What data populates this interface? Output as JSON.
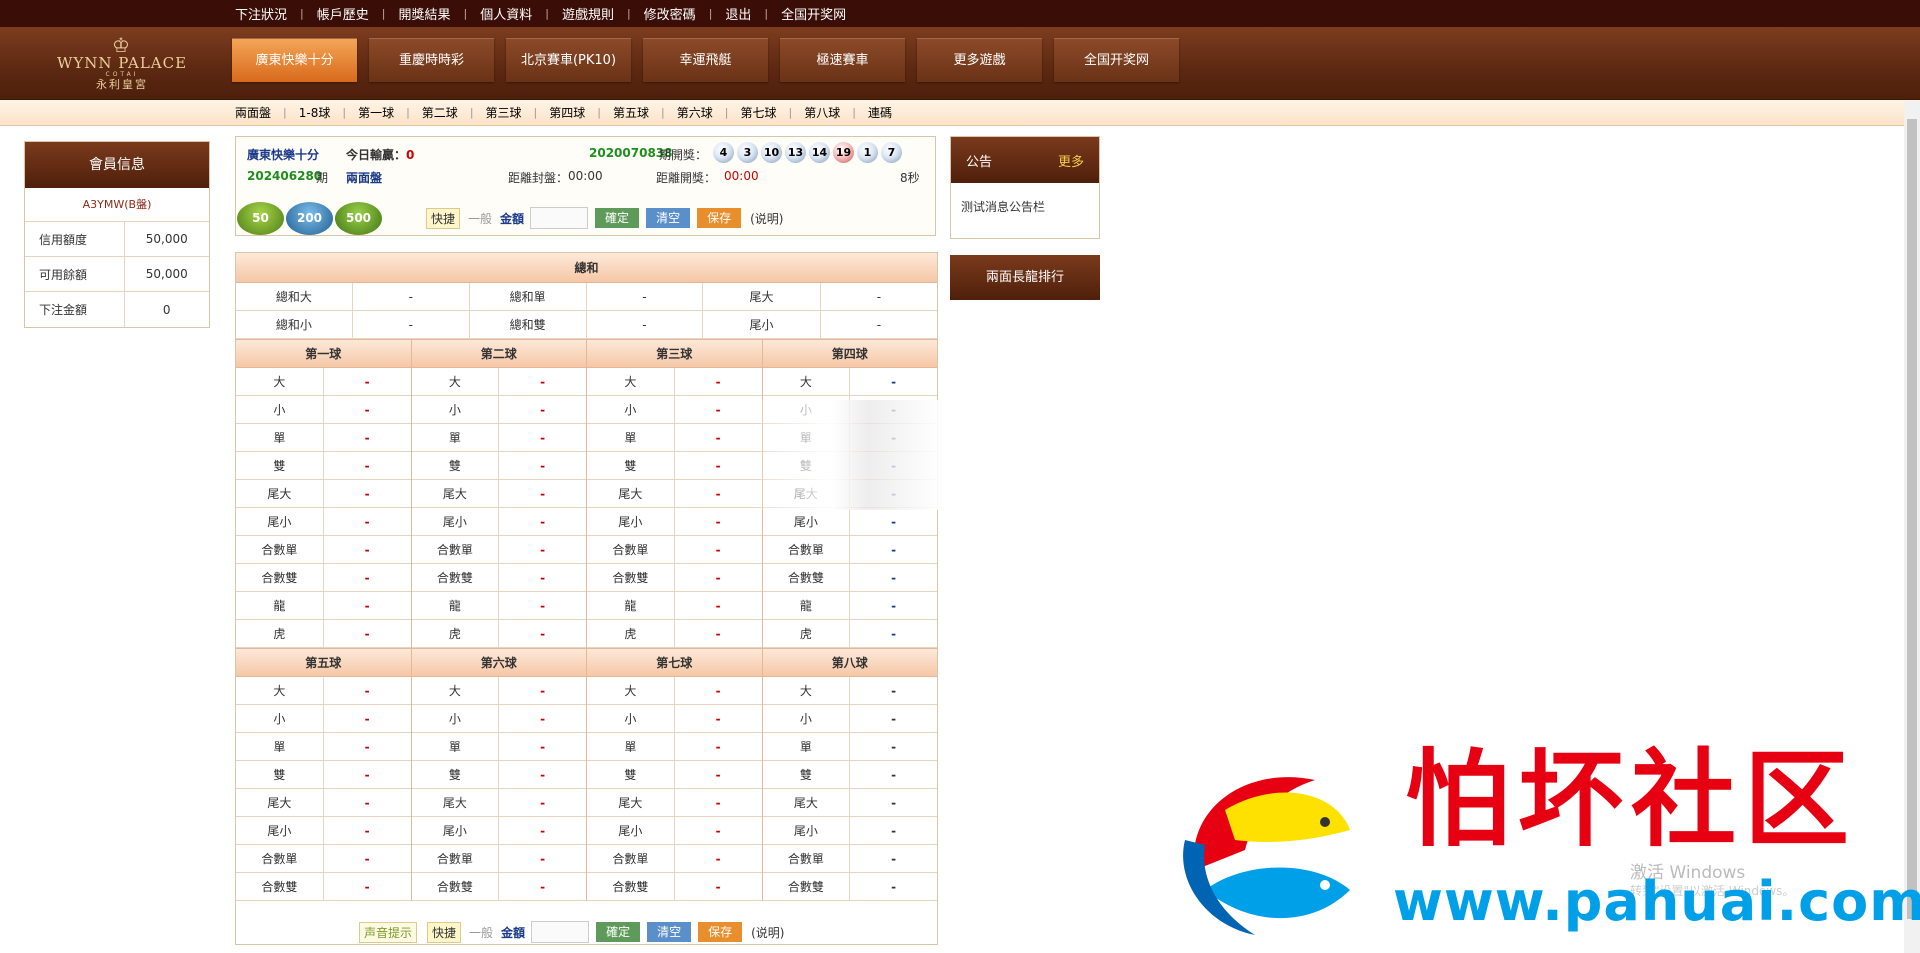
{
  "topnav": [
    "下注狀況",
    "帳戶歷史",
    "開獎結果",
    "個人資料",
    "遊戲規則",
    "修改密碼",
    "退出",
    "全国开奖网"
  ],
  "logo": {
    "en": "WYNN PALACE",
    "sub": "COTAI",
    "cn": "永利皇宮"
  },
  "games": [
    "廣東快樂十分",
    "重慶時時彩",
    "北京賽車(PK10)",
    "幸運飛艇",
    "極速賽車",
    "更多遊戲",
    "全国开奖网"
  ],
  "subnav": [
    "兩面盤",
    "1-8球",
    "第一球",
    "第二球",
    "第三球",
    "第四球",
    "第五球",
    "第六球",
    "第七球",
    "第八球",
    "連碼"
  ],
  "member": {
    "title": "會員信息",
    "user": "A3YMW(B盤)",
    "rows": [
      {
        "k": "信用額度",
        "v": "50,000"
      },
      {
        "k": "可用餘額",
        "v": "50,000"
      },
      {
        "k": "下注金額",
        "v": "0"
      }
    ]
  },
  "info": {
    "game": "廣東快樂十分",
    "today_label": "今日輸贏：",
    "today_val": "0",
    "draw_no": "2020070838",
    "draw_label": "期開獎：",
    "balls": [
      {
        "n": "4",
        "c": "blue"
      },
      {
        "n": "3",
        "c": "blue"
      },
      {
        "n": "10",
        "c": "blue"
      },
      {
        "n": "13",
        "c": "blue"
      },
      {
        "n": "14",
        "c": "blue"
      },
      {
        "n": "19",
        "c": "red"
      },
      {
        "n": "1",
        "c": "blue"
      },
      {
        "n": "7",
        "c": "blue"
      }
    ],
    "issue": "202406280",
    "qi": "期",
    "mode": "兩面盤",
    "close_label": "距離封盤：",
    "close_val": "00:00",
    "open_label": "距離開獎：",
    "open_val": "00:00",
    "secs": "8秒"
  },
  "chips": [
    "50",
    "200",
    "500"
  ],
  "tools": {
    "quick": "快捷",
    "normal": "一般",
    "amount": "金額",
    "ok": "確定",
    "clear": "清空",
    "save": "保存",
    "explain": "(说明)",
    "sound": "声音提示"
  },
  "sum": {
    "title": "總和",
    "rows": [
      [
        {
          "k": "總和大",
          "v": "-"
        },
        {
          "k": "總和單",
          "v": "-"
        },
        {
          "k": "尾大",
          "v": "-"
        }
      ],
      [
        {
          "k": "總和小",
          "v": "-"
        },
        {
          "k": "總和雙",
          "v": "-"
        },
        {
          "k": "尾小",
          "v": "-"
        }
      ]
    ]
  },
  "balls_top": {
    "heads": [
      "第一球",
      "第二球",
      "第三球",
      "第四球"
    ],
    "items": [
      "大",
      "小",
      "單",
      "雙",
      "尾大",
      "尾小",
      "合數單",
      "合數雙",
      "龍",
      "虎"
    ],
    "odd": "-"
  },
  "balls_bottom": {
    "heads": [
      "第五球",
      "第六球",
      "第七球",
      "第八球"
    ],
    "items": [
      "大",
      "小",
      "單",
      "雙",
      "尾大",
      "尾小",
      "合數單",
      "合數雙"
    ],
    "odd": "-"
  },
  "notice": {
    "title": "公告",
    "more": "更多",
    "text": "测试消息公告栏"
  },
  "longrank": "兩面長龍排行",
  "watermark": {
    "cn": "怕坏社区",
    "url": "www.pahuai.com"
  },
  "activate": {
    "l1": "激活 Windows",
    "l2": "转到\"设置\"以激活 Windows。"
  }
}
